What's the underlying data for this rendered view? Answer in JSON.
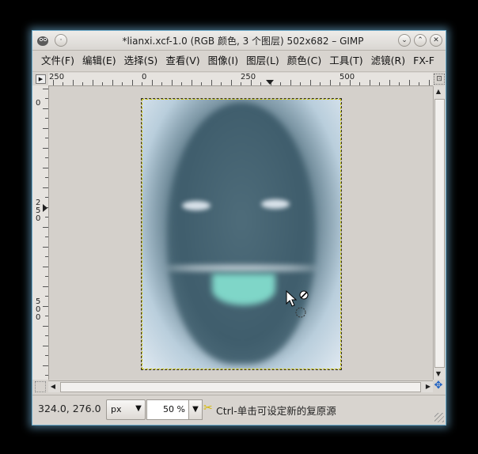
{
  "window": {
    "title": "*lianxi.xcf-1.0 (RGB 颜色, 3 个图层) 502x682 – GIMP",
    "app_icon": "gimp-wilber-icon",
    "minimize_symbol": "⌄",
    "maximize_symbol": "⌃",
    "close_symbol": "✕",
    "menu_symbol": "·"
  },
  "menubar": {
    "items": [
      {
        "label": "文件(F)"
      },
      {
        "label": "编辑(E)"
      },
      {
        "label": "选择(S)"
      },
      {
        "label": "查看(V)"
      },
      {
        "label": "图像(I)"
      },
      {
        "label": "图层(L)"
      },
      {
        "label": "颜色(C)"
      },
      {
        "label": "工具(T)"
      },
      {
        "label": "滤镜(R)"
      },
      {
        "label": "FX-F"
      }
    ]
  },
  "rulers": {
    "horizontal_labels": [
      "250",
      "0",
      "250",
      "500"
    ],
    "vertical_labels": [
      "0",
      "2\n5\n0",
      "5\n0\n0"
    ]
  },
  "canvas": {
    "image_description_icon": "inverted-face-image"
  },
  "statusbar": {
    "coords": "324.0, 276.0",
    "unit": "px",
    "zoom": "50 %",
    "message": "Ctrl-单击可设定新的复原源"
  },
  "colors": {
    "window_bg": "#d8d4cf",
    "glow": "#6aa8c8",
    "status_icon": "#d6b800",
    "nav_icon": "#1a5fc4"
  }
}
